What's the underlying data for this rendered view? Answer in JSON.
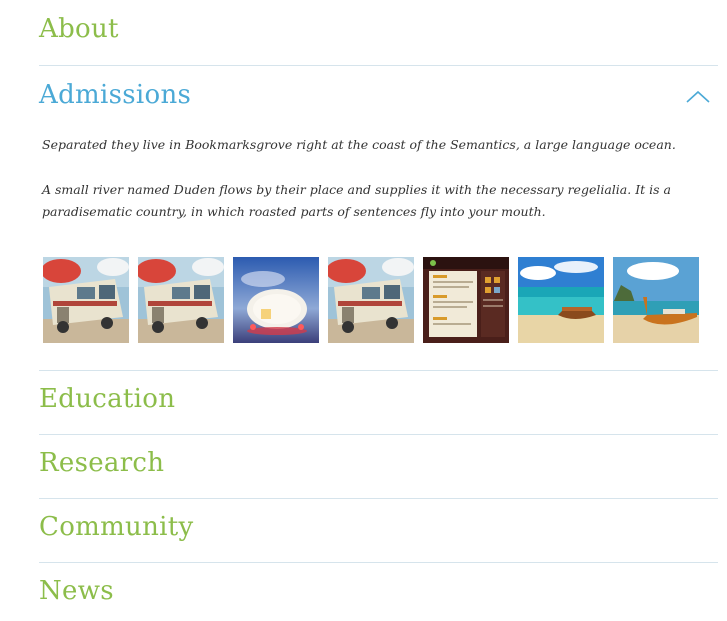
{
  "accordion": {
    "items": [
      {
        "label": "About",
        "expanded": false
      },
      {
        "label": "Admissions",
        "expanded": true
      },
      {
        "label": "Education",
        "expanded": false
      },
      {
        "label": "Research",
        "expanded": false
      },
      {
        "label": "Community",
        "expanded": false
      },
      {
        "label": "News",
        "expanded": false
      }
    ],
    "admissions_panel": {
      "paragraph_1": "Separated they live in Bookmarksgrove right at the coast of the Semantics, a large language ocean.",
      "paragraph_2": "A small river named Duden flows by their place and supplies it with the necessary regelialia. It is a paradisematic country, in which roasted parts of sentences fly into your mouth.",
      "thumbnails": [
        {
          "subject": "rv-camper"
        },
        {
          "subject": "rv-camper"
        },
        {
          "subject": "glowing-trailer"
        },
        {
          "subject": "rv-camper"
        },
        {
          "subject": "website-screenshot"
        },
        {
          "subject": "beach-boat"
        },
        {
          "subject": "longtail-boat"
        }
      ]
    }
  },
  "colors": {
    "collapsed_title": "#8cbd4a",
    "active_title": "#4ba9d6",
    "divider": "#d6e4ec",
    "body_text": "#333333"
  },
  "icons": {
    "collapse": "chevron-up-icon"
  }
}
